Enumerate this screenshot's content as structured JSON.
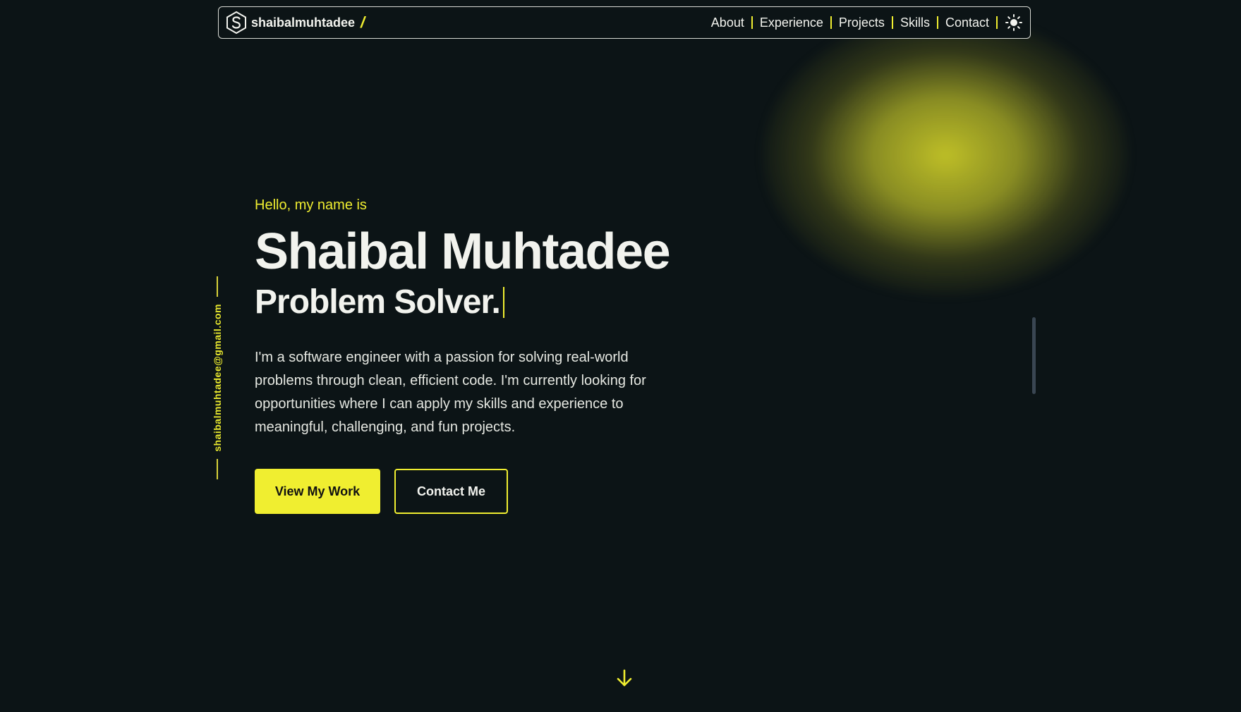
{
  "navbar": {
    "brand_name": "shaibalmuhtadee",
    "brand_slash": "/",
    "brand_logo_icon": "hexagon-s-logo-icon",
    "links": [
      {
        "label": "About"
      },
      {
        "label": "Experience"
      },
      {
        "label": "Projects"
      },
      {
        "label": "Skills"
      },
      {
        "label": "Contact"
      }
    ],
    "theme_toggle_icon": "sun-icon"
  },
  "side": {
    "email": "shaibalmuhtadee@gmail.com"
  },
  "hero": {
    "greeting": "Hello, my name is",
    "name": "Shaibal Muhtadee",
    "role": "Problem Solver.",
    "bio": "I'm a software engineer with a passion for solving real-world problems through clean, efficient code. I'm currently looking for opportunities where I can apply my skills and experience to meaningful, challenging, and fun projects.",
    "primary_cta": "View My Work",
    "secondary_cta": "Contact Me"
  },
  "scroll_down_icon": "arrow-down-icon",
  "colors": {
    "background": "#0c1416",
    "accent": "#f0ee30",
    "text": "#f2f3ee"
  }
}
